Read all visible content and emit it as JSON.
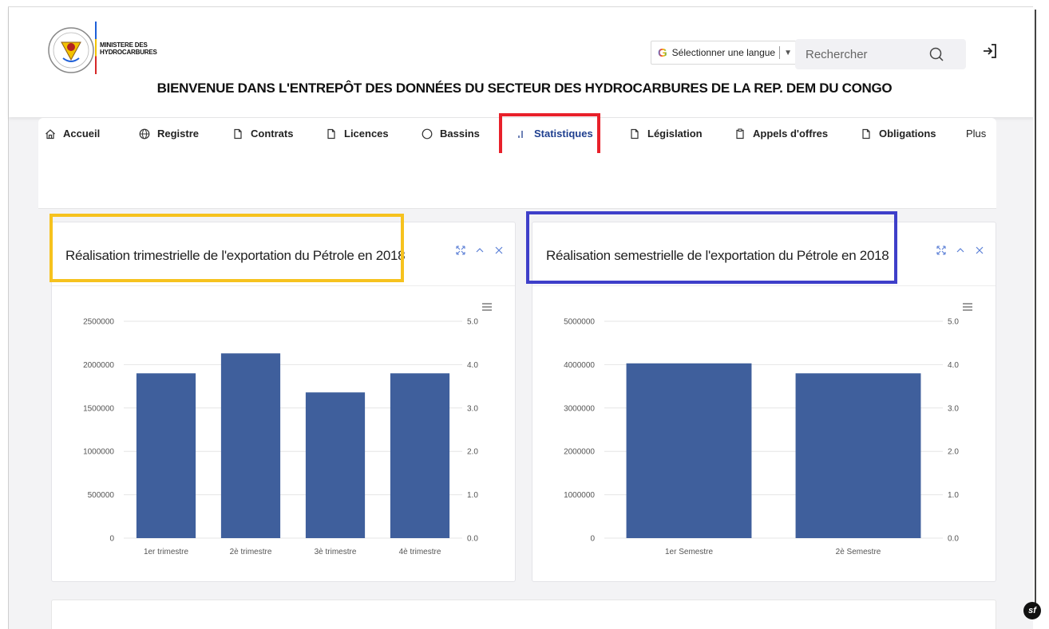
{
  "header": {
    "ministry_line1": "MINISTERE DES",
    "ministry_line2": "HYDROCARBURES",
    "language_label": "Sélectionner une langue",
    "search_placeholder": "Rechercher",
    "welcome": "BIENVENUE DANS L'ENTREPÔT DES DONNÉES DU SECTEUR DES HYDROCARBURES DE LA REP. DEM DU CONGO"
  },
  "nav": {
    "items": [
      {
        "label": "Accueil",
        "icon": "home-icon"
      },
      {
        "label": "Registre",
        "icon": "globe-icon"
      },
      {
        "label": "Contrats",
        "icon": "document-icon"
      },
      {
        "label": "Licences",
        "icon": "document-icon"
      },
      {
        "label": "Bassins",
        "icon": "circle-icon"
      },
      {
        "label": "Statistiques",
        "icon": "bar-chart-icon",
        "active": true
      },
      {
        "label": "Législation",
        "icon": "document-icon"
      },
      {
        "label": "Appels d'offres",
        "icon": "clipboard-icon"
      },
      {
        "label": "Obligations",
        "icon": "document-icon"
      },
      {
        "label": "Plus",
        "icon": ""
      }
    ]
  },
  "colors": {
    "bar": "#3f5f9c",
    "active_nav": "#1f3f8f",
    "highlight_red": "#e8202a",
    "highlight_yellow": "#f6c21e",
    "highlight_blue": "#3e3fc9"
  },
  "chart_data": [
    {
      "type": "bar",
      "title": "Réalisation trimestrielle de l'exportation du Pétrole en 2018",
      "categories": [
        "1er trimestre",
        "2è trimestre",
        "3è trimestre",
        "4è trimestre"
      ],
      "values": [
        1900000,
        2130000,
        1680000,
        1900000
      ],
      "ylim": [
        0,
        2500000
      ],
      "y_ticks": [
        "0",
        "500000",
        "1000000",
        "1500000",
        "2000000",
        "2500000"
      ],
      "y2lim": [
        0,
        5
      ],
      "y2_ticks": [
        "0.0",
        "1.0",
        "2.0",
        "3.0",
        "4.0",
        "5.0"
      ],
      "grid": true
    },
    {
      "type": "bar",
      "title": "Réalisation semestrielle de l'exportation du Pétrole en 2018",
      "categories": [
        "1er Semestre",
        "2è Semestre"
      ],
      "values": [
        4030000,
        3800000
      ],
      "ylim": [
        0,
        5000000
      ],
      "y_ticks": [
        "0",
        "1000000",
        "2000000",
        "3000000",
        "4000000",
        "5000000"
      ],
      "y2lim": [
        0,
        5
      ],
      "y2_ticks": [
        "0.0",
        "1.0",
        "2.0",
        "3.0",
        "4.0",
        "5.0"
      ],
      "grid": true
    }
  ]
}
